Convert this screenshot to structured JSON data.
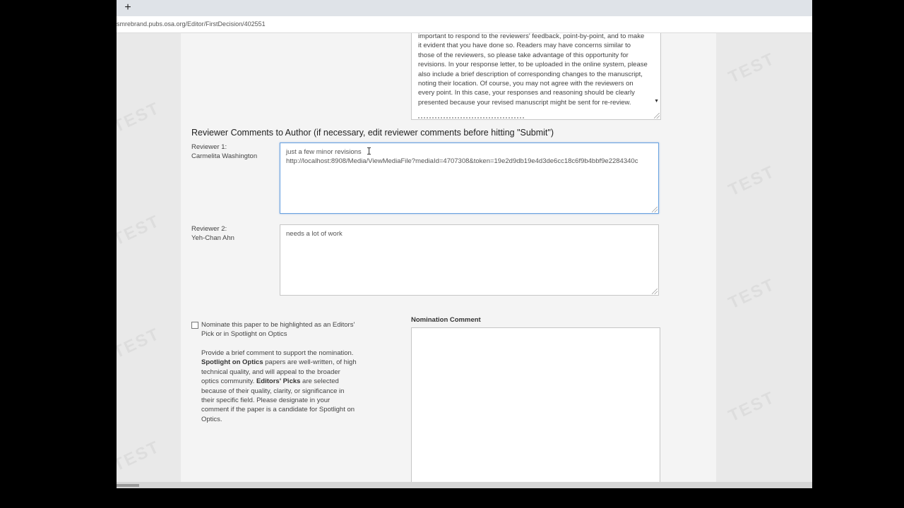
{
  "browser": {
    "new_tab_label": "+",
    "url": "smrebrand.pubs.osa.org/Editor/FirstDecision/402551"
  },
  "watermark": "TEST",
  "letter": {
    "text": "important to respond to the reviewers' feedback, point-by-point, and to make it evident that you have done so.  Readers may have concerns similar to those of the reviewers, so please take advantage of this opportunity for revisions.  In your response letter, to be uploaded in the online system, please also include a brief description of corresponding changes to the manuscript, noting their location.  Of course, you may not agree with the reviewers on every point. In this case, your responses and reasoning should be clearly presented because your revised manuscript might be sent for re-review."
  },
  "reviewer_section": {
    "heading": "Reviewer Comments to Author (if necessary, edit reviewer comments before hitting \"Submit\")",
    "reviewers": [
      {
        "label": "Reviewer 1:",
        "name": "Carmelita Washington",
        "comment": "just a few minor revisions\nhttp://localhost:8908/Media/ViewMediaFile?mediaId=4707308&token=19e2d9db19e4d3de6cc18c6f9b4bbf9e2284340c"
      },
      {
        "label": "Reviewer 2:",
        "name": "Yeh-Chan Ahn",
        "comment": "needs a lot of work"
      }
    ]
  },
  "nomination": {
    "checkbox_label": "Nominate this paper to be highlighted as an Editors' Pick or in Spotlight on Optics",
    "checked": false,
    "help_intro": "Provide a brief comment to support the nomination.",
    "spotlight_term": "Spotlight on Optics",
    "spotlight_desc": " papers are well-written, of high technical quality, and will appeal to the broader optics community. ",
    "editors_term": "Editors' Picks",
    "editors_desc": " are selected because of their quality, clarity, or significance in their specific field. Please designate in your comment if the paper is a candidate for Spotlight on Optics.",
    "comment_label": "Nomination Comment",
    "comment_value": ""
  }
}
